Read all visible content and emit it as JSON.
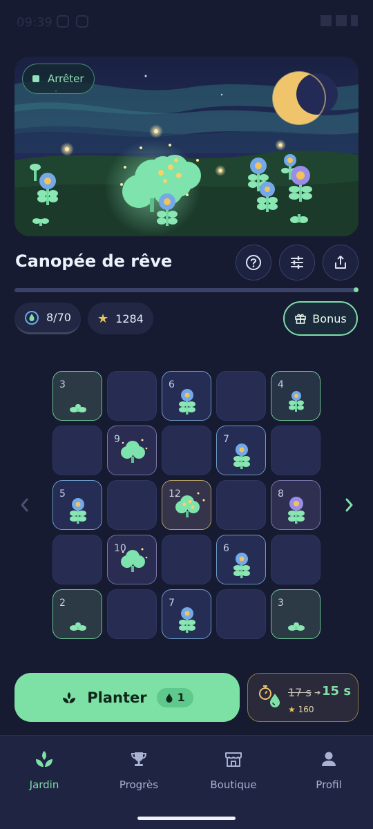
{
  "status_bar": {
    "time": "09:39"
  },
  "hero": {
    "stop_label": "Arrêter"
  },
  "garden": {
    "title": "Canopée de rêve",
    "progress": 1.0,
    "water": "8/70",
    "stars": "1284",
    "bonus_label": "Bonus"
  },
  "grid": {
    "rows": 5,
    "cols": 5,
    "cells": [
      {
        "r": 0,
        "c": 0,
        "n": "3",
        "kind": "sprout"
      },
      {
        "r": 0,
        "c": 2,
        "n": "6",
        "kind": "flower-blue"
      },
      {
        "r": 0,
        "c": 4,
        "n": "4",
        "kind": "flower-small"
      },
      {
        "r": 1,
        "c": 1,
        "n": "9",
        "kind": "bush"
      },
      {
        "r": 1,
        "c": 3,
        "n": "7",
        "kind": "flower-blue"
      },
      {
        "r": 2,
        "c": 0,
        "n": "5",
        "kind": "flower-blue"
      },
      {
        "r": 2,
        "c": 2,
        "n": "12",
        "kind": "bush-gold"
      },
      {
        "r": 2,
        "c": 4,
        "n": "8",
        "kind": "flower-purple"
      },
      {
        "r": 3,
        "c": 1,
        "n": "10",
        "kind": "bush"
      },
      {
        "r": 3,
        "c": 3,
        "n": "6",
        "kind": "flower-blue"
      },
      {
        "r": 4,
        "c": 0,
        "n": "2",
        "kind": "sprout"
      },
      {
        "r": 4,
        "c": 2,
        "n": "7",
        "kind": "flower-blue"
      },
      {
        "r": 4,
        "c": 4,
        "n": "3",
        "kind": "sprout"
      }
    ]
  },
  "actions": {
    "plant_label": "Planter",
    "plant_cost": "1",
    "timer_old": "17 s",
    "timer_new": "15 s",
    "timer_cost": "160"
  },
  "nav": {
    "items": [
      {
        "label": "Jardin",
        "icon": "sprout-icon",
        "active": true
      },
      {
        "label": "Progrès",
        "icon": "trophy-icon",
        "active": false
      },
      {
        "label": "Boutique",
        "icon": "store-icon",
        "active": false
      },
      {
        "label": "Profil",
        "icon": "person-icon",
        "active": false
      }
    ]
  },
  "colors": {
    "accent": "#7de0a5",
    "background": "#161b31",
    "gold": "#e8c35a"
  }
}
